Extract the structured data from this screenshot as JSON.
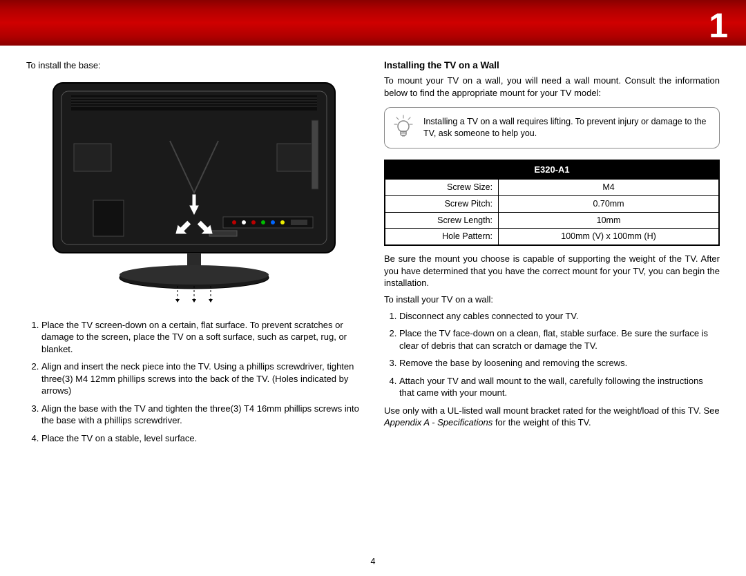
{
  "chapter_number": "1",
  "page_number": "4",
  "left": {
    "intro": "To install the base:",
    "steps": [
      "Place the TV screen-down on a certain, flat surface. To prevent scratches or damage to the screen, place the TV on a soft surface, such as carpet, rug, or blanket.",
      "Align and insert the neck piece into the TV. Using a phillips screwdriver, tighten three(3) M4 12mm phillips screws into the back of the TV. (Holes indicated by arrows)",
      "Align the base with the TV and tighten the three(3) T4 16mm phillips screws into the base with a phillips screwdriver.",
      "Place the TV on a stable, level surface."
    ]
  },
  "right": {
    "heading": "Installing the TV on a Wall",
    "intro": "To mount your TV on a wall, you will need a wall mount. Consult the information below to find the appropriate mount for your TV model:",
    "callout": "Installing a TV on a wall requires lifting. To prevent injury or damage to the TV, ask someone to help you.",
    "table": {
      "header": "E320-A1",
      "rows": [
        {
          "label": "Screw Size:",
          "value": "M4"
        },
        {
          "label": "Screw Pitch:",
          "value": "0.70mm"
        },
        {
          "label": "Screw Length:",
          "value": "10mm"
        },
        {
          "label": "Hole Pattern:",
          "value": "100mm (V) x 100mm (H)"
        }
      ]
    },
    "after_table": "Be sure the mount you choose is capable of supporting the weight of the TV. After you have determined that you have the correct mount for your TV, you can begin the installation.",
    "steps_intro": "To install your TV on a wall:",
    "steps": [
      "Disconnect any cables connected to your TV.",
      "Place the TV face-down on a clean, flat, stable surface. Be sure the surface is clear of debris that can scratch or damage the TV.",
      "Remove the base by loosening and removing the screws.",
      "Attach your TV and wall mount to the wall, carefully following the instructions that came with your mount."
    ],
    "note_prefix": "Use only with a UL-listed wall mount bracket rated for the weight/load of this TV. See ",
    "note_italic": "Appendix A - Specifications",
    "note_suffix": " for the weight of this TV."
  }
}
